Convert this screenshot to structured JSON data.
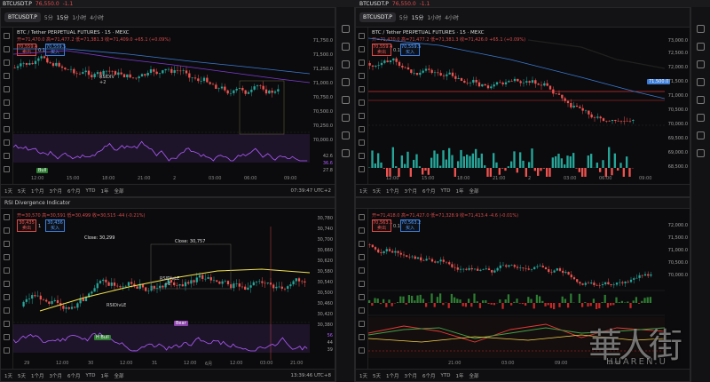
{
  "topbar": {
    "left": {
      "symbol": "BTCUSDT.P",
      "price": "76,550.0",
      "change": "-1.1"
    },
    "right": {
      "symbol": "BTCUSDT.P",
      "price": "76,550.0",
      "change": "-1.1"
    }
  },
  "panes": [
    {
      "symbol": "BTCUSDT.P",
      "intervals": [
        "5分",
        "15分",
        "1小时",
        "4小时"
      ],
      "title": "BTC / Tether PERPETUAL FUTURES · 15 · MEXC",
      "ohlc": "开=71,470.0 高=71,477.2 低=71,381.3 收=71,409.0 +65.1 (+0.09%)",
      "sell": {
        "price": "70,559.4",
        "label": "卖出"
      },
      "buy": {
        "price": "70,559.5",
        "label": "买入"
      },
      "spread": "0.1",
      "prices": [
        "71,750.0",
        "71,500.0",
        "71,250.0",
        "71,000.0",
        "70,750.0",
        "70,500.0",
        "70,250.0",
        "70,000.0"
      ],
      "times": [
        "12:00",
        "15:00",
        "18:00",
        "21:00",
        "2",
        "03:00",
        "06:00",
        "09:00"
      ],
      "periods": [
        "1天",
        "5天",
        "1个月",
        "3个月",
        "6个月",
        "YTD",
        "1年",
        "全部"
      ],
      "clock": "07:39:47 UTC+2",
      "rsi_levels": [
        "42.6",
        "36.6",
        "27.8"
      ],
      "bull_label": "Bull",
      "labels": [
        "RSIDIV",
        "+2"
      ]
    },
    {
      "symbol": "BTCUSDT.P",
      "intervals": [
        "5分",
        "15分",
        "1小时",
        "4小时"
      ],
      "title": "BTC / Tether PERPETUAL FUTURES · 15 · MEXC",
      "ohlc": "开=71,470.0 高=71,477.2 低=71,381.3 收=71,426.0 +65.1 (+0.09%)",
      "sell": {
        "price": "70,559.4",
        "label": "卖出"
      },
      "buy": {
        "price": "70,559.5",
        "label": "买入"
      },
      "spread": "0.1",
      "prices": [
        "73,000.0",
        "72,500.0",
        "72,000.0",
        "71,500.0",
        "71,000.0",
        "70,500.0",
        "70,000.0",
        "69,500.0",
        "69,000.0",
        "68,500.0"
      ],
      "times": [
        "12:00",
        "15:00",
        "18:00",
        "21:00",
        "2",
        "03:00",
        "06:00",
        "09:00"
      ],
      "periods": [
        "1天",
        "5天",
        "1个月",
        "3个月",
        "6个月",
        "YTD",
        "1年",
        "全部"
      ],
      "clock": ""
    },
    {
      "symbol": "",
      "title": "RSI Divergence Indicator",
      "ohlc": "开=30,570 高=30,591 低=30,499 收=30,515 -44 (-0.21%)",
      "sell": {
        "price": "30,435",
        "label": "卖出"
      },
      "buy": {
        "price": "30,436",
        "label": "买入"
      },
      "spread": "1",
      "prices": [
        "30,780",
        "30,740",
        "30,700",
        "30,660",
        "30,620",
        "30,580",
        "30,540",
        "30,500",
        "30,460",
        "30,420",
        "30,380"
      ],
      "times": [
        "29",
        "12:00",
        "30",
        "12:00",
        "31",
        "12:00",
        "6月",
        "12:00",
        "03:00",
        "21:00"
      ],
      "periods": [
        "1天",
        "5天",
        "1个月",
        "3个月",
        "6个月",
        "YTD",
        "1年",
        "全部"
      ],
      "clock": "13:39:46 UTC+8",
      "rsi_levels": [
        "56",
        "44",
        "39"
      ],
      "labels": [
        "Close: 30,299",
        "Close: 30,757",
        "RSIDivLE",
        "RSIDivLE",
        "+2"
      ],
      "bear_label": "Bear",
      "bull_label": "H Bull"
    },
    {
      "symbol": "",
      "title": "",
      "ohlc": "开=71,418.0 高=71,427.0 低=71,328.9 收=71,413.4 -4.6 (-0.01%)",
      "sell": {
        "price": "70,563.1",
        "label": "卖出"
      },
      "buy": {
        "price": "70,563.2",
        "label": "买入"
      },
      "spread": "0.1",
      "prices": [
        "72,000.0",
        "71,500.0",
        "71,000.0",
        "70,500.0",
        "70,000.0"
      ],
      "times": [
        "21:00",
        "03:00",
        "09:00",
        "15:00"
      ],
      "periods": [
        "1天",
        "5天",
        "1个月",
        "3个月",
        "6个月",
        "YTD",
        "1年",
        "全部"
      ],
      "clock": ""
    }
  ],
  "watermark": {
    "chars": "華人街",
    "sub": "HUAREN.U"
  },
  "colors": {
    "up": "#26a69a",
    "down": "#ef5350",
    "rsi": "#b05cff",
    "sma": "#f2e24e",
    "blue": "#3a7bd5"
  }
}
